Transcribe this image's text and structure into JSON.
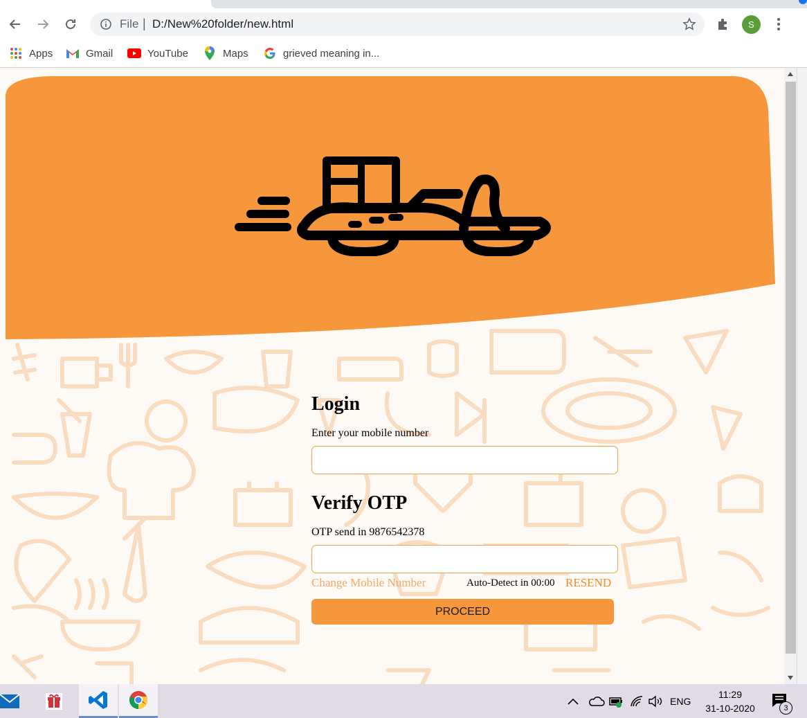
{
  "browser": {
    "url_scheme": "File",
    "url_separator": "|",
    "url": "D:/New%20folder/new.html",
    "profile_initial": "S",
    "nav": {
      "back_icon": "arrow-left-icon",
      "forward_icon": "arrow-right-icon",
      "reload_icon": "reload-icon"
    }
  },
  "bookmarks": [
    {
      "label": "Apps",
      "icon": "apps-grid-icon"
    },
    {
      "label": "Gmail",
      "icon": "gmail-icon"
    },
    {
      "label": "YouTube",
      "icon": "youtube-icon"
    },
    {
      "label": "Maps",
      "icon": "maps-pin-icon"
    },
    {
      "label": "grieved meaning in...",
      "icon": "google-icon"
    }
  ],
  "page": {
    "logo_icon": "delivery-scooter-icon",
    "login": {
      "heading": "Login",
      "mobile_label": "Enter your mobile number",
      "mobile_value": ""
    },
    "otp": {
      "heading": "Verify OTP",
      "sent_label": "OTP send in 9876542378",
      "otp_value": "",
      "change_link": "Change Mobile Number",
      "autodetect": "Auto-Detect in 00:00",
      "resend_link": "RESEND"
    },
    "proceed_label": "PROCEED",
    "colors": {
      "accent": "#F5973A",
      "pattern": "#F9DCC0"
    }
  },
  "taskbar": {
    "apps": [
      "mail-icon",
      "gift-icon",
      "vscode-icon",
      "chrome-icon"
    ],
    "language": "ENG",
    "time": "11:29",
    "date": "31-10-2020",
    "notifications": "3"
  }
}
